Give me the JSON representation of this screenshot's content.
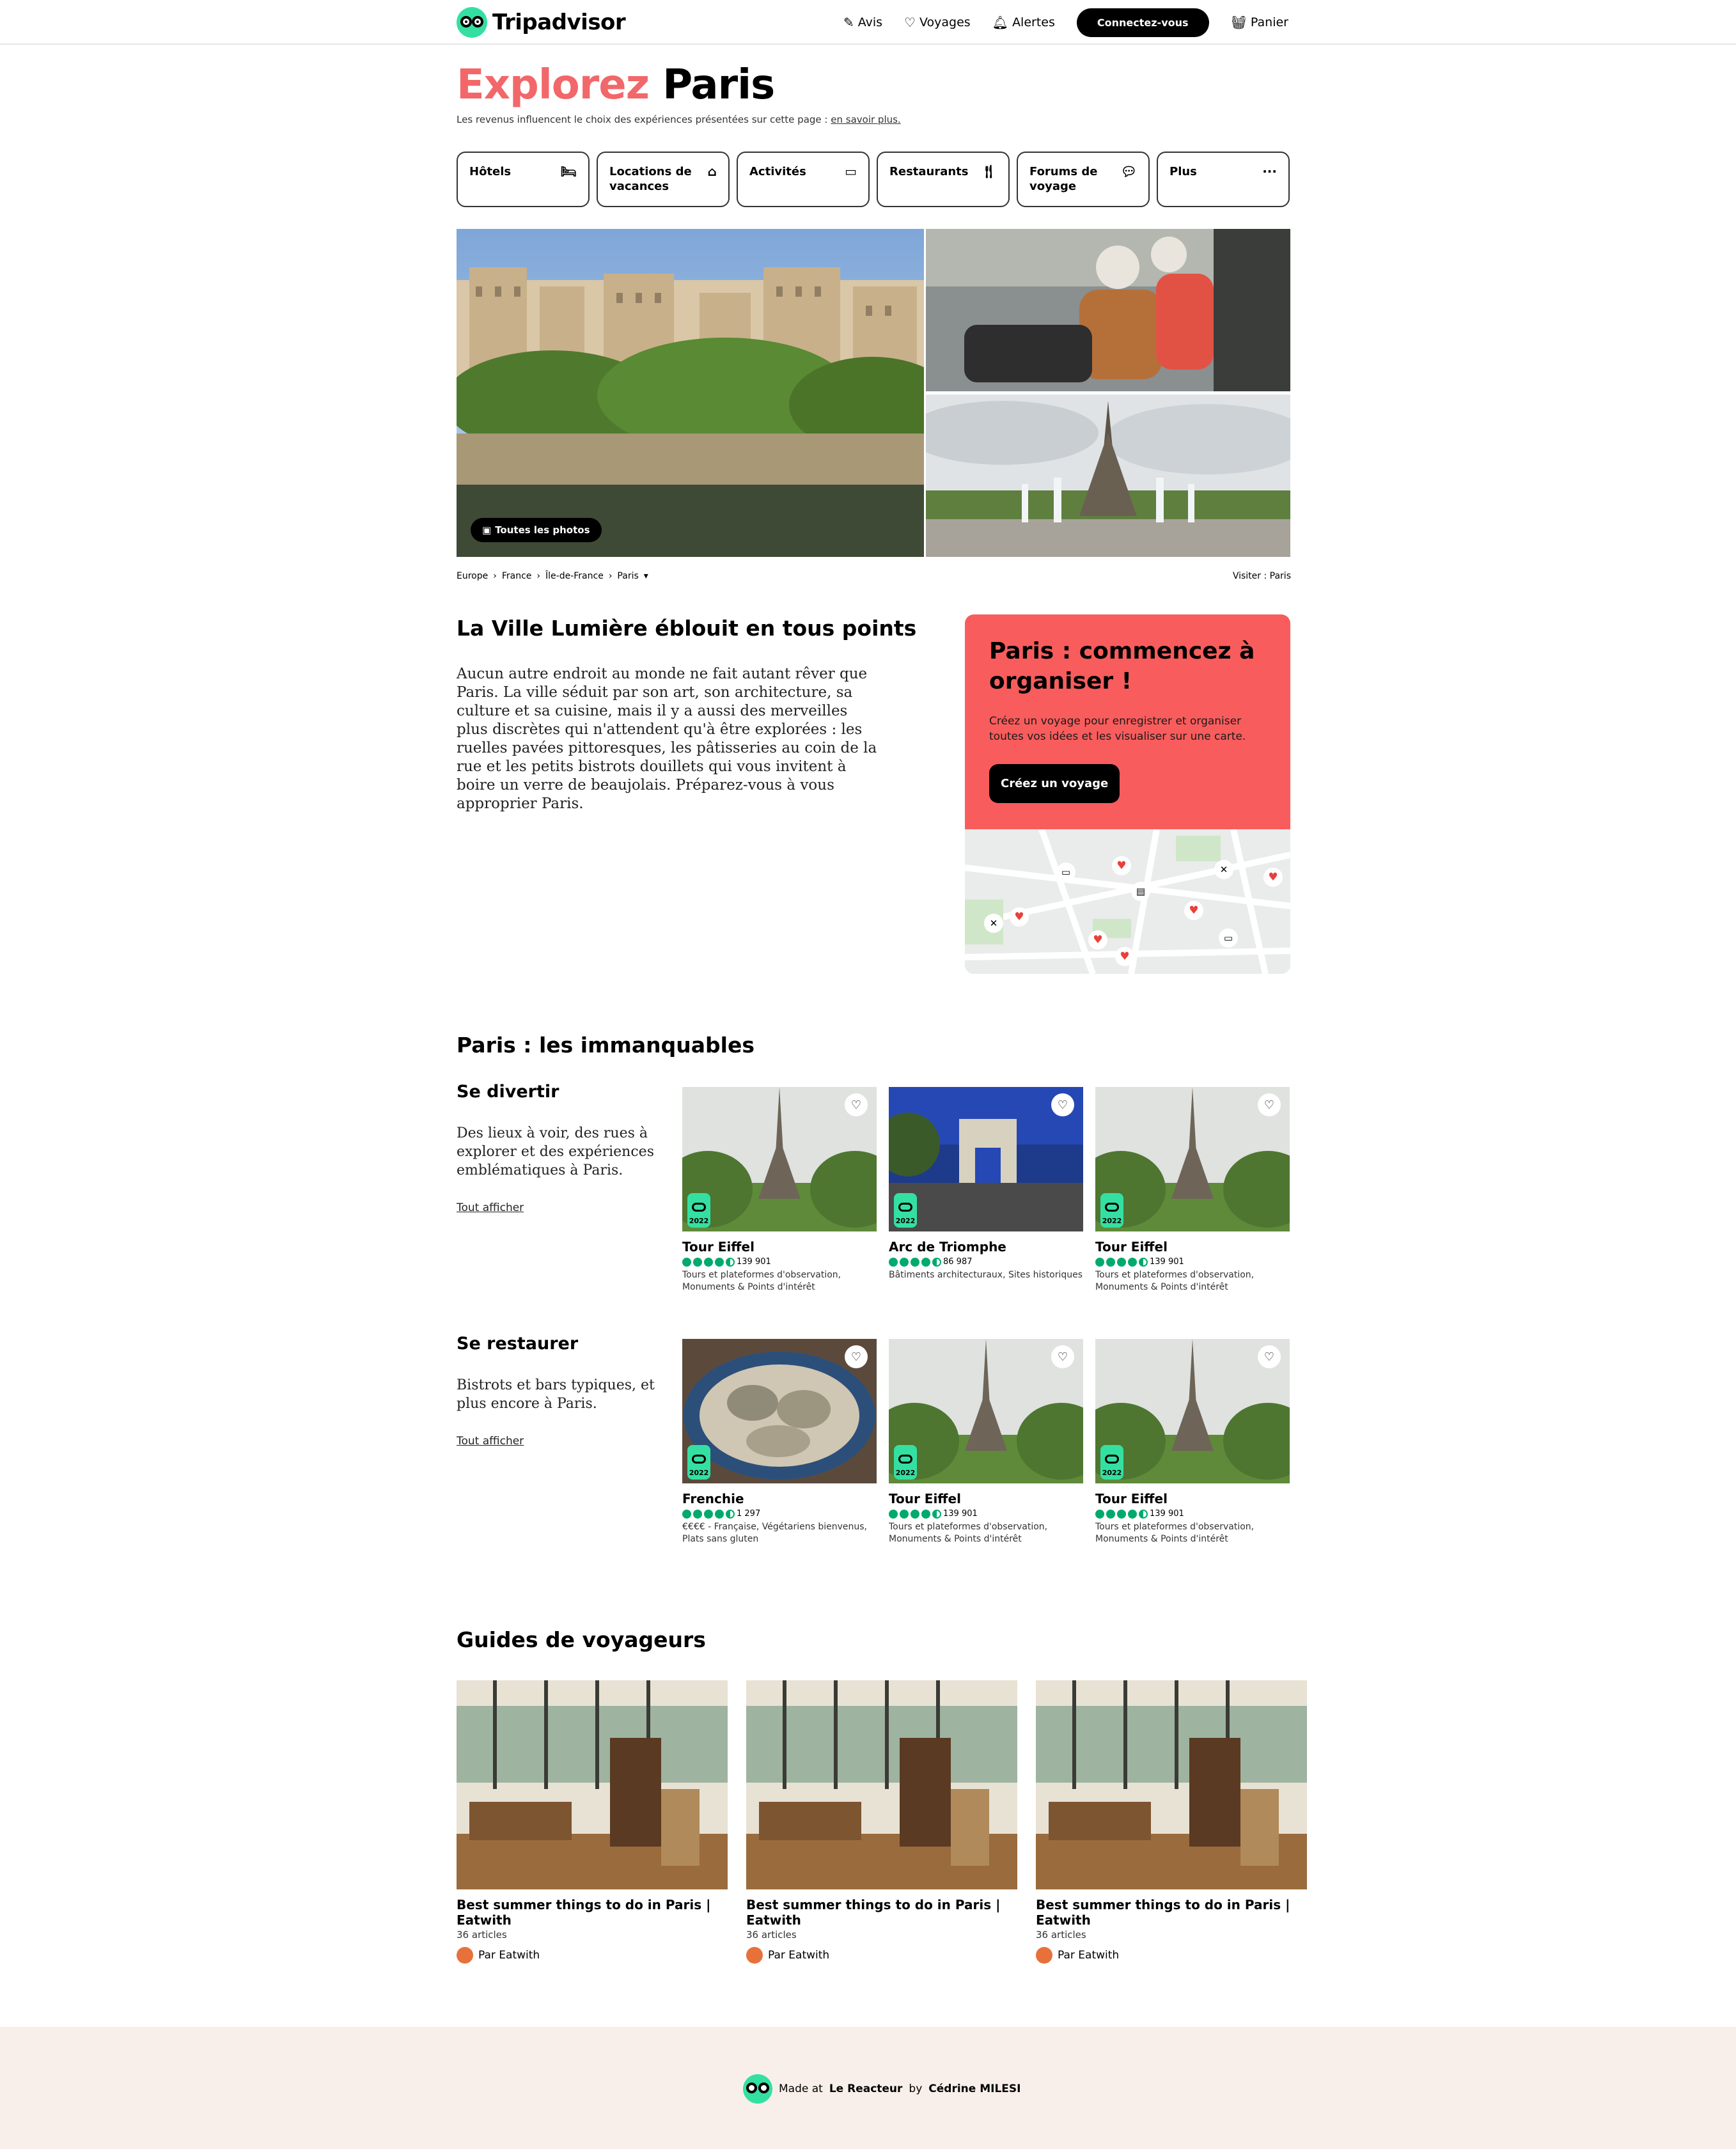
{
  "header": {
    "logo": "Tripadvisor",
    "nav": [
      {
        "label": "Avis",
        "icon": "pencil-icon"
      },
      {
        "label": "Voyages",
        "icon": "heart-icon"
      },
      {
        "label": "Alertes",
        "icon": "bell-icon"
      }
    ],
    "connect_label": "Connectez-vous",
    "cart_label": "Panier"
  },
  "hero": {
    "title_accent": "Explorez",
    "title_city": "Paris",
    "disclaimer": "Les revenus influencent le choix des expériences présentées sur cette page :",
    "disclaimer_link": "en savoir plus."
  },
  "tabs": [
    {
      "label": "Hôtels",
      "icon": "bed-icon"
    },
    {
      "label": "Locations de vacances",
      "icon": "house-icon"
    },
    {
      "label": "Activités",
      "icon": "ticket-icon"
    },
    {
      "label": "Restaurants",
      "icon": "fork-knife-icon"
    },
    {
      "label": "Forums de voyage",
      "icon": "chat-icon"
    },
    {
      "label": "Plus",
      "icon": "ellipsis-icon"
    }
  ],
  "photos": {
    "all_photos_label": "Toutes les photos"
  },
  "breadcrumb": [
    "Europe",
    "France",
    "Île-de-France",
    "Paris"
  ],
  "visit_label": "Visiter : Paris",
  "intro": {
    "heading": "La Ville Lumière éblouit en tous points",
    "text": "Aucun autre endroit au monde ne fait autant rêver que Paris. La ville séduit par son art, son architecture, sa culture et sa cuisine, mais il y a aussi des merveilles plus discrètes qui n'attendent qu'à être explorées : les ruelles pavées pittoresques, les pâtisseries au coin de la rue et les petits bistrots douillets qui vous invitent à boire un verre de beaujolais. Préparez-vous à vous approprier Paris."
  },
  "trip": {
    "heading": "Paris : commencez à organiser !",
    "text": "Créez un voyage pour enregistrer et organiser toutes vos idées et les visualiser sur une carte.",
    "button": "Créez un voyage"
  },
  "must_see": {
    "heading": "Paris : les immanquables",
    "sections": [
      {
        "title": "Se divertir",
        "text": "Des lieux à voir, des rues à explorer et des expériences emblématiques à Paris.",
        "link": "Tout afficher",
        "cards": [
          {
            "name": "Tour Eiffel",
            "reviews": "139 901",
            "rating": 4.5,
            "category": "Tours et plateformes d'observation, Monuments & Points d'intérêt",
            "badge": "2022",
            "image": "eiffel"
          },
          {
            "name": "Arc de Triomphe",
            "reviews": "86 987",
            "rating": 4.5,
            "category": "Bâtiments architecturaux, Sites historiques",
            "badge": "2022",
            "image": "arc"
          },
          {
            "name": "Tour Eiffel",
            "reviews": "139 901",
            "rating": 4.5,
            "category": "Tours et plateformes d'observation, Monuments & Points d'intérêt",
            "badge": "2022",
            "image": "eiffel"
          }
        ]
      },
      {
        "title": "Se restaurer",
        "text": "Bistrots et bars typiques, et plus encore à Paris.",
        "link": "Tout afficher",
        "cards": [
          {
            "name": "Frenchie",
            "reviews": "1 297",
            "rating": 4.5,
            "category": "€€€€ - Française, Végétariens bienvenus, Plats sans gluten",
            "badge": "2022",
            "image": "food"
          },
          {
            "name": "Tour Eiffel",
            "reviews": "139 901",
            "rating": 4.5,
            "category": "Tours et plateformes d'observation, Monuments & Points d'intérêt",
            "badge": "2022",
            "image": "eiffel"
          },
          {
            "name": "Tour Eiffel",
            "reviews": "139 901",
            "rating": 4.5,
            "category": "Tours et plateformes d'observation, Monuments & Points d'intérêt",
            "badge": "2022",
            "image": "eiffel"
          }
        ]
      }
    ]
  },
  "guides": {
    "heading": "Guides de voyageurs",
    "items": [
      {
        "title": "Best summer things to do in Paris | Eatwith",
        "count": "36 articles",
        "author": "Par Eatwith"
      },
      {
        "title": "Best summer things to do in Paris | Eatwith",
        "count": "36 articles",
        "author": "Par Eatwith"
      },
      {
        "title": "Best summer things to do in Paris | Eatwith",
        "count": "36 articles",
        "author": "Par Eatwith"
      }
    ]
  },
  "footer": {
    "made_at": "Made at",
    "place": "Le Reacteur",
    "by": "by",
    "author": "Cédrine MILESI"
  },
  "colors": {
    "accent": "#f2676a",
    "brand_green": "#34e0a1",
    "trip_card": "#f95c5c",
    "rating_green": "#00aa6c",
    "footer_bg": "#f9efea"
  }
}
